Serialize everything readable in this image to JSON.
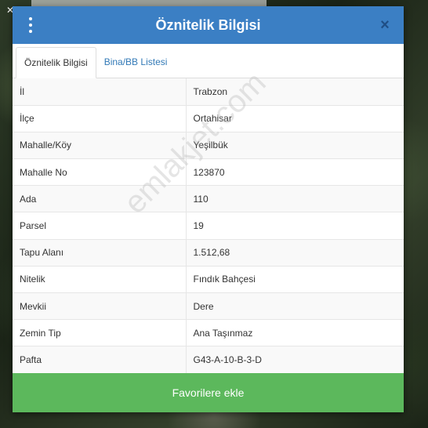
{
  "header": {
    "title": "Öznitelik Bilgisi",
    "close_glyph": "×",
    "menu_icon": "kebab-menu-icon"
  },
  "tabs": [
    {
      "label": "Öznitelik Bilgisi",
      "active": true
    },
    {
      "label": "Bina/BB Listesi",
      "active": false
    }
  ],
  "attributes": [
    {
      "key": "İl",
      "value": "Trabzon"
    },
    {
      "key": "İlçe",
      "value": "Ortahisar"
    },
    {
      "key": "Mahalle/Köy",
      "value": "Yeşilbük"
    },
    {
      "key": "Mahalle No",
      "value": "123870"
    },
    {
      "key": "Ada",
      "value": "110"
    },
    {
      "key": "Parsel",
      "value": "19"
    },
    {
      "key": "Tapu Alanı",
      "value": "1.512,68"
    },
    {
      "key": "Nitelik",
      "value": "Fındık Bahçesi"
    },
    {
      "key": "Mevkii",
      "value": "Dere"
    },
    {
      "key": "Zemin Tip",
      "value": "Ana Taşınmaz"
    },
    {
      "key": "Pafta",
      "value": "G43-A-10-B-3-D"
    }
  ],
  "footer": {
    "favorite_label": "Favorilere ekle"
  },
  "watermark": "emlakjet.com",
  "colors": {
    "header": "#3b7fc4",
    "tab_link": "#337ab7",
    "favorite_button": "#5cb85c"
  }
}
